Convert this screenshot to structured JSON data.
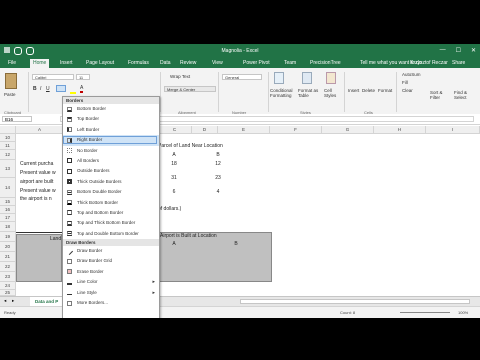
{
  "window": {
    "title": "Magnolia - Excel"
  },
  "tabs": [
    "File",
    "Home",
    "Insert",
    "Page Layout",
    "Formulas",
    "Data",
    "Review",
    "View",
    "Power Pivot",
    "Team",
    "PrecisionTree"
  ],
  "active_tab": "Home",
  "tell_me": "Tell me what you want to do",
  "account": "Krzysztof Reczar",
  "share": "Share",
  "ribbon": {
    "clipboard": {
      "paste": "Paste",
      "group": "Clipboard"
    },
    "font": {
      "name": "Calibri",
      "size": "11"
    },
    "alignment": {
      "wrap": "Wrap Text",
      "merge": "Merge & Center",
      "group": "Alignment"
    },
    "number": {
      "format": "General",
      "group": "Number"
    },
    "styles": {
      "conditional": "Conditional Formatting",
      "format_table": "Format as Table",
      "cell_styles": "Cell Styles",
      "group": "Styles"
    },
    "cells": {
      "insert": "Insert",
      "delete": "Delete",
      "format": "Format",
      "group": "Cells"
    },
    "editing": {
      "autosum": "AutoSum",
      "fill": "Fill",
      "clear": "Clear",
      "sort": "Sort & Filter",
      "find": "Find & Select"
    }
  },
  "formula_bar": {
    "name_box": "B16"
  },
  "columns": [
    "A",
    "B",
    "C",
    "D",
    "E",
    "F",
    "G",
    "H",
    "I"
  ],
  "rows": [
    "10",
    "11",
    "12",
    "13",
    "14",
    "15",
    "16",
    "17",
    "18",
    "19",
    "20",
    "21",
    "22",
    "23",
    "24",
    "25"
  ],
  "cells": {
    "parcel_title": "Parcel of Land Near Location",
    "col_a": "A",
    "col_b": "B",
    "val_18": "18",
    "val_12": "12",
    "val_31": "31",
    "val_23": "23",
    "val_6": "6",
    "val_4": "4",
    "current_purchase": "Current purcha",
    "present_value_1": "Present value w",
    "airport_built": "airport are built",
    "present_value_2": "Present value w",
    "airport_not": "the airport is n",
    "of_dollars": "of dollars.)",
    "airport_title": "Airport is Built at Location",
    "lower_a": "A",
    "lower_b": "B",
    "land_label": "Land"
  },
  "border_menu": {
    "header": "Borders",
    "items": [
      "Bottom Border",
      "Top Border",
      "Left Border",
      "Right Border",
      "No Border",
      "All Borders",
      "Outside Borders",
      "Thick Outside Borders",
      "Bottom Double Border",
      "Thick Bottom Border",
      "Top and Bottom Border",
      "Top and Thick Bottom Border",
      "Top and Double Bottom Border"
    ],
    "draw_header": "Draw Borders",
    "draw_items": [
      "Draw Border",
      "Draw Border Grid",
      "Erase Border",
      "Line Color",
      "Line Style",
      "More Borders..."
    ],
    "highlighted": "Right Border"
  },
  "sheet_tab": "Data and P",
  "status": {
    "left": "Ready",
    "count": "Count: 8",
    "zoom": "100%"
  }
}
